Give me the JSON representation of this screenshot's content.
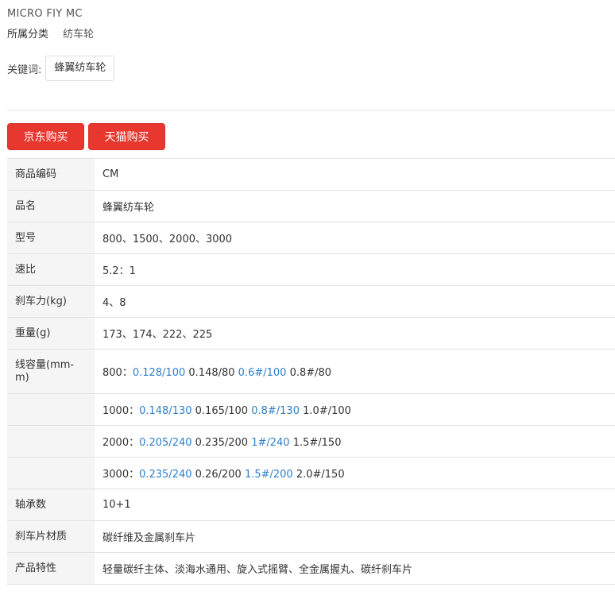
{
  "product": {
    "title": "MICRO FIY MC",
    "category_label": "所属分类",
    "category_value": "纺车轮",
    "keywords_label": "关键词:",
    "keyword_tag": "蜂翼纺车轮"
  },
  "buttons": {
    "jd": "京东购买",
    "tmall": "天猫购买"
  },
  "colors": {
    "accent_red": "#e8372f",
    "link_blue": "#2e7fc8"
  },
  "specs": [
    {
      "key": "商品编码",
      "value": "CM"
    },
    {
      "key": "品名",
      "value": "蜂翼纺车轮"
    },
    {
      "key": "型号",
      "value": "800、1500、2000、3000"
    },
    {
      "key": "速比",
      "value": "5.2：1"
    },
    {
      "key": "刹车力(kg)",
      "value": "4、8"
    },
    {
      "key": "重量(g)",
      "value": "173、174、222、225"
    }
  ],
  "line_capacity": {
    "key": "线容量(mm-m)",
    "rows": [
      {
        "prefix": "800：",
        "b1": "0.128/100",
        "d1": "0.148/80",
        "b2": "0.6#/100",
        "d2": "0.8#/80"
      },
      {
        "prefix": "1000：",
        "b1": "0.148/130",
        "d1": "0.165/100",
        "b2": "0.8#/130",
        "d2": "1.0#/100"
      },
      {
        "prefix": "2000：",
        "b1": "0.205/240",
        "d1": "0.235/200",
        "b2": "1#/240",
        "d2": "1.5#/150"
      },
      {
        "prefix": "3000：",
        "b1": "0.235/240",
        "d1": "0.26/200",
        "b2": "1.5#/200",
        "d2": "2.0#/150"
      }
    ]
  },
  "specs_tail": [
    {
      "key": "轴承数",
      "value": "10+1"
    },
    {
      "key": "刹车片材质",
      "value": "碳纤维及金属刹车片"
    },
    {
      "key": "产品特性",
      "value": "轻量碳纤主体、淡海水通用、旋入式摇臂、全金属握丸、碳纤刹车片"
    }
  ]
}
